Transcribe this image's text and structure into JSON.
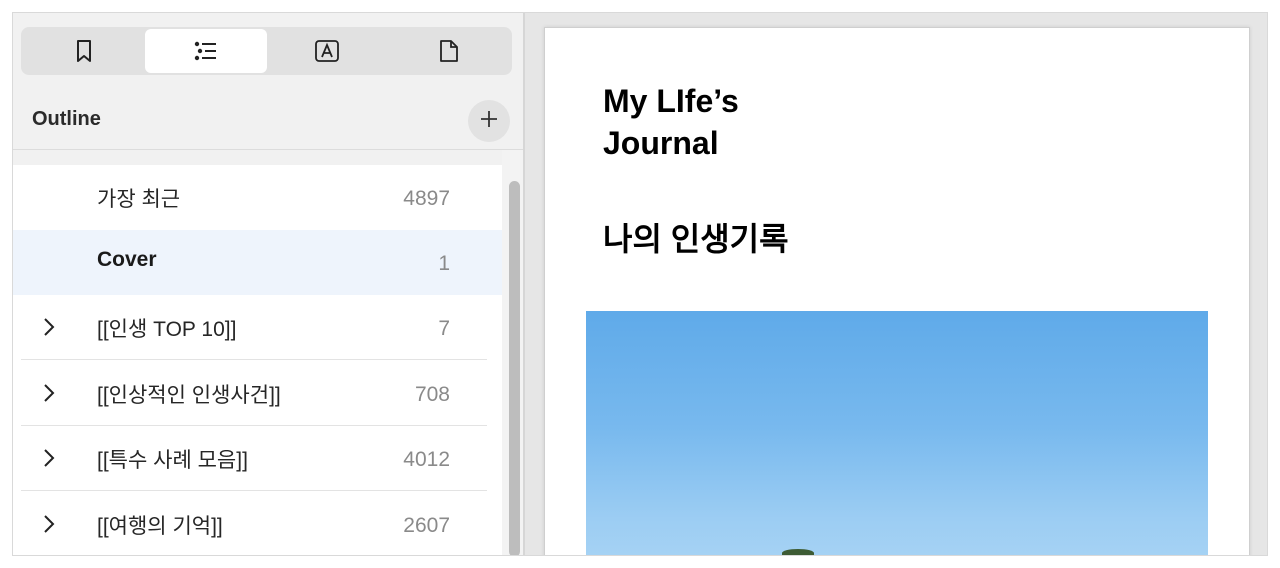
{
  "sidebar": {
    "tabs": [
      {
        "name": "bookmark",
        "icon": "bookmark-icon"
      },
      {
        "name": "outline",
        "icon": "list-icon",
        "active": true
      },
      {
        "name": "annotations",
        "icon": "text-box-icon"
      },
      {
        "name": "pages",
        "icon": "page-icon"
      }
    ],
    "outline_title": "Outline",
    "add_icon": "plus-icon",
    "items": [
      {
        "label": "가장 최근",
        "count": "4897",
        "expandable": false,
        "selected": false
      },
      {
        "label": "Cover",
        "count": "1",
        "expandable": false,
        "selected": true
      },
      {
        "label": "[[인생 TOP 10]]",
        "count": "7",
        "expandable": true,
        "selected": false
      },
      {
        "label": "[[인상적인 인생사건]]",
        "count": "708",
        "expandable": true,
        "selected": false
      },
      {
        "label": "[[특수 사례 모음]]",
        "count": "4012",
        "expandable": true,
        "selected": false
      },
      {
        "label": "[[여행의 기억]]",
        "count": "2607",
        "expandable": true,
        "selected": false
      }
    ]
  },
  "document": {
    "title_line1": "My LIfe’s",
    "title_line2": "Journal",
    "subtitle": "나의 인생기록",
    "image": "sky-photo"
  },
  "colors": {
    "selected_row": "#eef4fc",
    "active_tab": "#ffffff",
    "sky": "#6fb3ec"
  }
}
